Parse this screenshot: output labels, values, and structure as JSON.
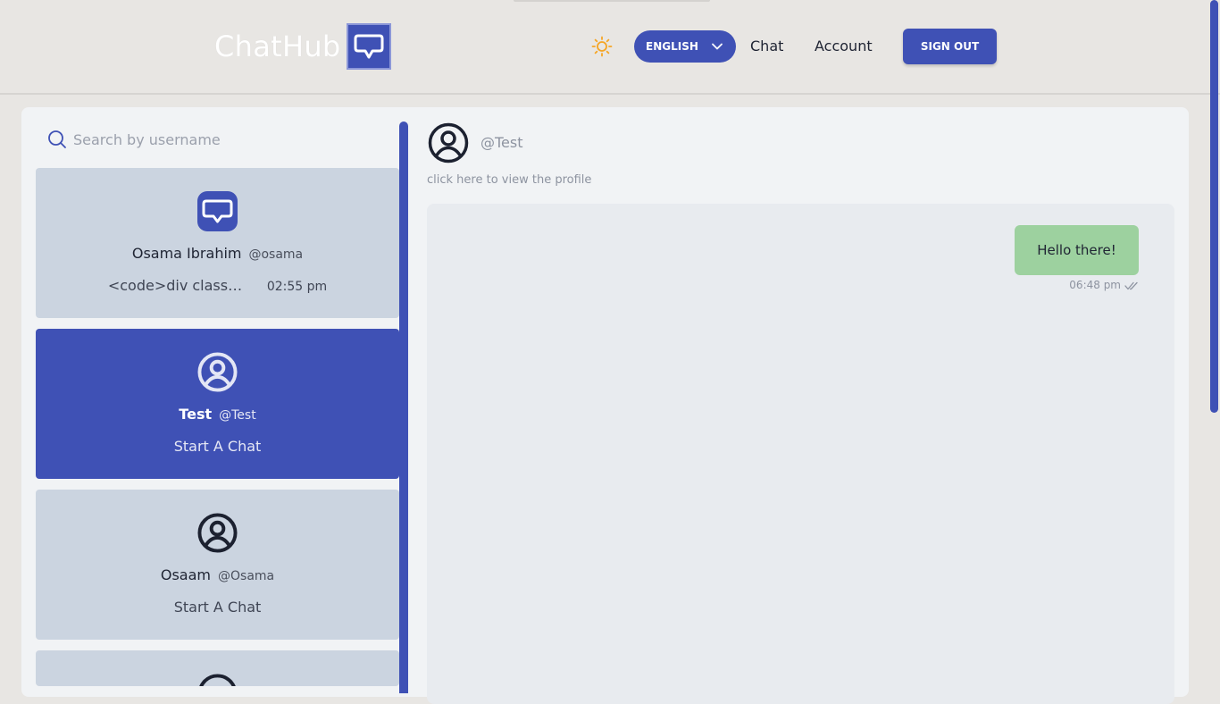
{
  "app": {
    "name": "ChatHub",
    "accent_color": "#3f51b5",
    "bubble_color": "#9dd19f",
    "theme_icon": "sun-icon"
  },
  "header": {
    "language": "ENGLISH",
    "nav": {
      "chat": "Chat",
      "account": "Account"
    },
    "sign_out": "SIGN OUT"
  },
  "search": {
    "placeholder": "Search by username",
    "value": ""
  },
  "contacts": [
    {
      "name": "Osama Ibrahim",
      "handle": "@osama",
      "preview": "<code>div classN...",
      "time": "02:55 pm",
      "avatar": "chat-bubble-logo",
      "active": false
    },
    {
      "name": "Test",
      "handle": "@Test",
      "preview": "Start A Chat",
      "time": "",
      "avatar": "user-circle-icon",
      "active": true
    },
    {
      "name": "Osaam",
      "handle": "@Osama",
      "preview": "Start A Chat",
      "time": "",
      "avatar": "user-circle-icon",
      "active": false
    }
  ],
  "conversation": {
    "handle": "@Test",
    "profile_link": "click here to view the profile",
    "messages": [
      {
        "text": "Hello there!",
        "time": "06:48 pm",
        "status": "read"
      }
    ]
  }
}
